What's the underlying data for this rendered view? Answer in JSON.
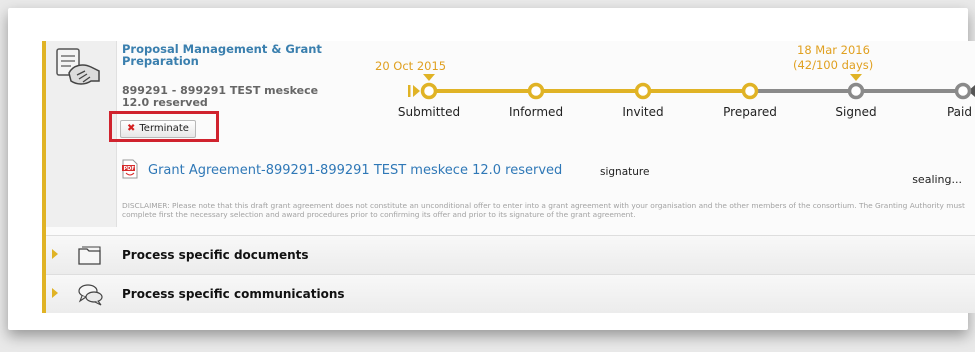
{
  "process": {
    "title": "Proposal Management & Grant Preparation",
    "subtitle_line1": "899291 - 899291 TEST meskece",
    "subtitle_line2": "12.0 reserved",
    "terminate_label": "Terminate"
  },
  "timeline": {
    "start_date": "20 Oct 2015",
    "current_date": "18 Mar 2016",
    "current_days": "(42/100 days)",
    "steps": [
      "Submitted",
      "Informed",
      "Invited",
      "Prepared",
      "Signed",
      "Paid"
    ],
    "completed_steps": 4,
    "colors": {
      "done": "#e0b325",
      "pending": "#8a8a8a",
      "date": "#e0a020"
    }
  },
  "document": {
    "link": "Grant Agreement-899291-899291 TEST meskece 12.0 reserved",
    "tag": "signature",
    "status": "sealing...",
    "disclaimer": "DISCLAIMER: Please note that this draft grant agreement does not constitute an unconditional offer to enter into a grant agreement with your organisation and the other members of the consortium. The Granting Authority must complete first the necessary selection and award procedures prior to confirming its offer and prior to its signature of the grant agreement."
  },
  "sections": [
    {
      "label": "Process specific documents",
      "icon": "folder-icon"
    },
    {
      "label": "Process specific communications",
      "icon": "chat-bubbles-icon"
    }
  ]
}
